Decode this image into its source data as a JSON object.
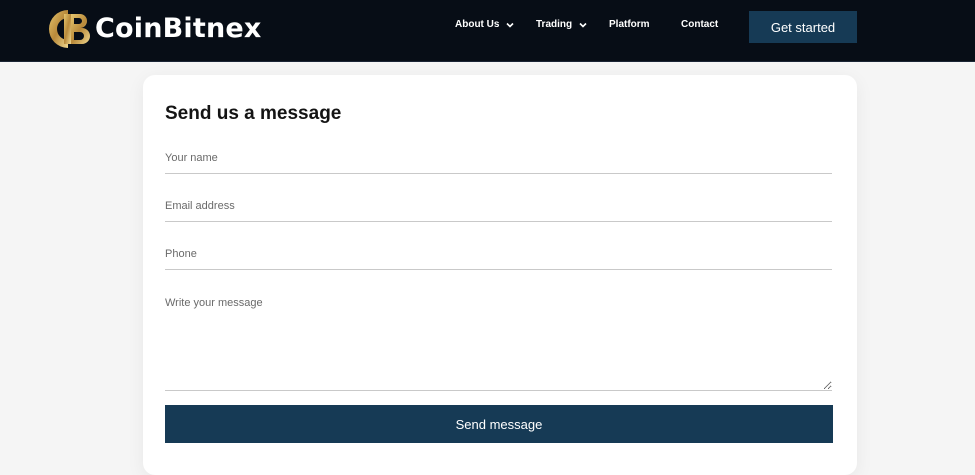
{
  "brand": {
    "name": "CoinBitnex",
    "logo_icon": "cb-logo-icon",
    "logo_color": "#c9a24a"
  },
  "nav": {
    "items": [
      {
        "label": "About Us",
        "has_dropdown": true
      },
      {
        "label": "Trading",
        "has_dropdown": true
      },
      {
        "label": "Platform",
        "has_dropdown": false
      },
      {
        "label": "Contact",
        "has_dropdown": false
      }
    ],
    "cta_label": "Get started"
  },
  "form": {
    "title": "Send us a message",
    "name_placeholder": "Your name",
    "email_placeholder": "Email address",
    "phone_placeholder": "Phone",
    "message_placeholder": "Write your message",
    "submit_label": "Send message"
  },
  "colors": {
    "navbar_bg": "#070d16",
    "accent": "#163a55",
    "page_bg": "#f5f5f5"
  }
}
